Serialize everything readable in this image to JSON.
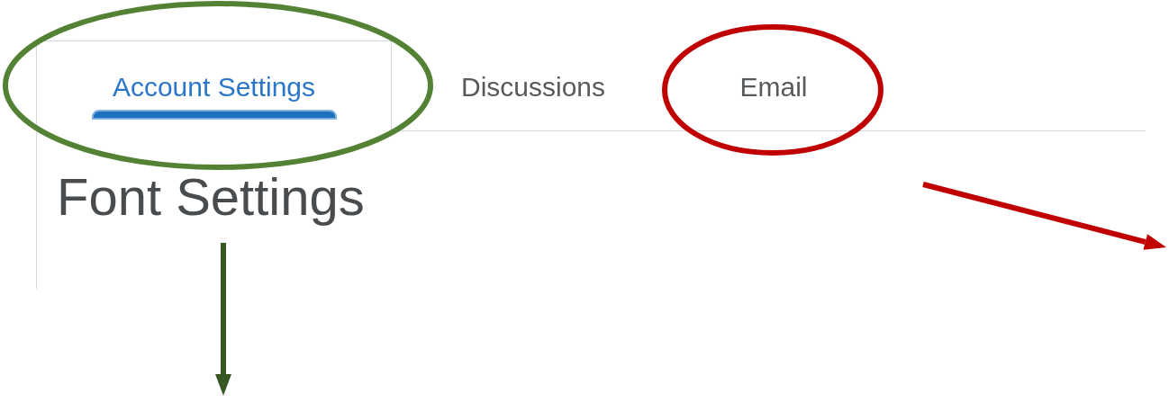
{
  "tabs": [
    {
      "label": "Account Settings",
      "selected": true
    },
    {
      "label": "Discussions",
      "selected": false
    },
    {
      "label": "Email",
      "selected": false
    }
  ],
  "heading": "Font Settings",
  "annotations": [
    {
      "kind": "ellipse",
      "color": "#548235"
    },
    {
      "kind": "ellipse",
      "color": "#c00000"
    },
    {
      "kind": "arrow",
      "color": "#c00000"
    },
    {
      "kind": "arrow",
      "color": "#375623"
    }
  ]
}
